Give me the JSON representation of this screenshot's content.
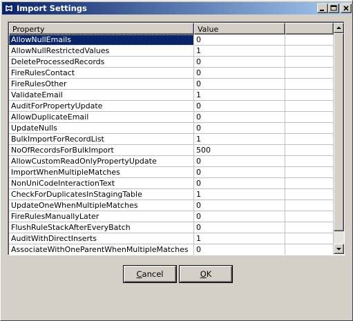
{
  "window": {
    "title": "Import Settings"
  },
  "table": {
    "headers": [
      "Property",
      "Value",
      ""
    ],
    "selected_index": 0,
    "rows": [
      {
        "property": "AllowNullEmails",
        "value": "0"
      },
      {
        "property": "AllowNullRestrictedValues",
        "value": "1"
      },
      {
        "property": "DeleteProcessedRecords",
        "value": "0"
      },
      {
        "property": "FireRulesContact",
        "value": "0"
      },
      {
        "property": "FireRulesOther",
        "value": "0"
      },
      {
        "property": "ValidateEmail",
        "value": "1"
      },
      {
        "property": "AuditForPropertyUpdate",
        "value": "0"
      },
      {
        "property": "AllowDuplicateEmail",
        "value": "0"
      },
      {
        "property": "UpdateNulls",
        "value": "0"
      },
      {
        "property": "BulkImportForRecordList",
        "value": "1"
      },
      {
        "property": "NoOfRecordsForBulkImport",
        "value": "500"
      },
      {
        "property": "AllowCustomReadOnlyPropertyUpdate",
        "value": "0"
      },
      {
        "property": "ImportWhenMultipleMatches",
        "value": "0"
      },
      {
        "property": "NonUniCodeInteractionText",
        "value": "0"
      },
      {
        "property": "CheckForDuplicatesInStagingTable",
        "value": "1"
      },
      {
        "property": "UpdateOneWhenMultipleMatches",
        "value": "0"
      },
      {
        "property": "FireRulesManuallyLater",
        "value": "0"
      },
      {
        "property": "FlushRuleStackAfterEveryBatch",
        "value": "0"
      },
      {
        "property": "AuditWithDirectInserts",
        "value": "1"
      },
      {
        "property": "AssociateWithOneParentWhenMultipleMatches",
        "value": "0"
      }
    ]
  },
  "buttons": {
    "cancel_first": "C",
    "cancel_rest": "ancel",
    "ok_first": "O",
    "ok_rest": "K"
  },
  "colors": {
    "title_gradient_start": "#0a246a",
    "title_gradient_end": "#a6caf0",
    "selection": "#0a246a",
    "face": "#d4d0c8"
  },
  "icons": {
    "title": "app-logo-icon",
    "minimize": "minimize-icon",
    "maximize": "maximize-icon",
    "close": "close-icon",
    "scroll_up": "arrow-up-icon",
    "scroll_down": "arrow-down-icon"
  }
}
